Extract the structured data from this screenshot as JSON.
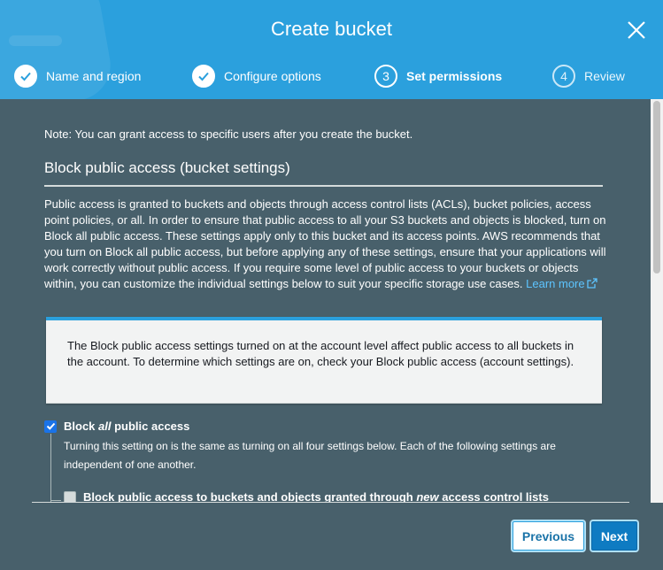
{
  "dialog": {
    "title": "Create bucket",
    "close_icon": "close-icon"
  },
  "steps": [
    {
      "number": "1",
      "label": "Name and region",
      "state": "done"
    },
    {
      "number": "2",
      "label": "Configure options",
      "state": "done"
    },
    {
      "number": "3",
      "label": "Set permissions",
      "state": "active"
    },
    {
      "number": "4",
      "label": "Review",
      "state": "todo"
    }
  ],
  "content": {
    "note": "Note: You can grant access to specific users after you create the bucket.",
    "section_title": "Block public access (bucket settings)",
    "description": "Public access is granted to buckets and objects through access control lists (ACLs), bucket policies, access point policies, or all. In order to ensure that public access to all your S3 buckets and objects is blocked, turn on Block all public access. These settings apply only to this bucket and its access points. AWS recommends that you turn on Block all public access, but before applying any of these settings, ensure that your applications will work correctly without public access. If you require some level of public access to your buckets or objects within, you can customize the individual settings below to suit your specific storage use cases.",
    "learn_more": "Learn more",
    "info_box": "The Block public access settings turned on at the account level affect public access to all buckets in the account. To determine which settings are on, check your Block public access (account settings).",
    "block_all": {
      "label_prefix": "Block ",
      "label_em": "all",
      "label_suffix": " public access",
      "checked": true,
      "help": "Turning this setting on is the same as turning on all four settings below. Each of the following settings are independent of one another."
    },
    "sub_setting": {
      "label_prefix": "Block public access to buckets and objects granted through ",
      "label_em": "new",
      "label_suffix": " access control lists",
      "checked": true
    }
  },
  "footer": {
    "previous_label": "Previous",
    "next_label": "Next"
  },
  "colors": {
    "header": "#2ba0dd",
    "background": "#48606b",
    "link": "#5dc4ff",
    "primary_button": "#0e7bc2"
  }
}
